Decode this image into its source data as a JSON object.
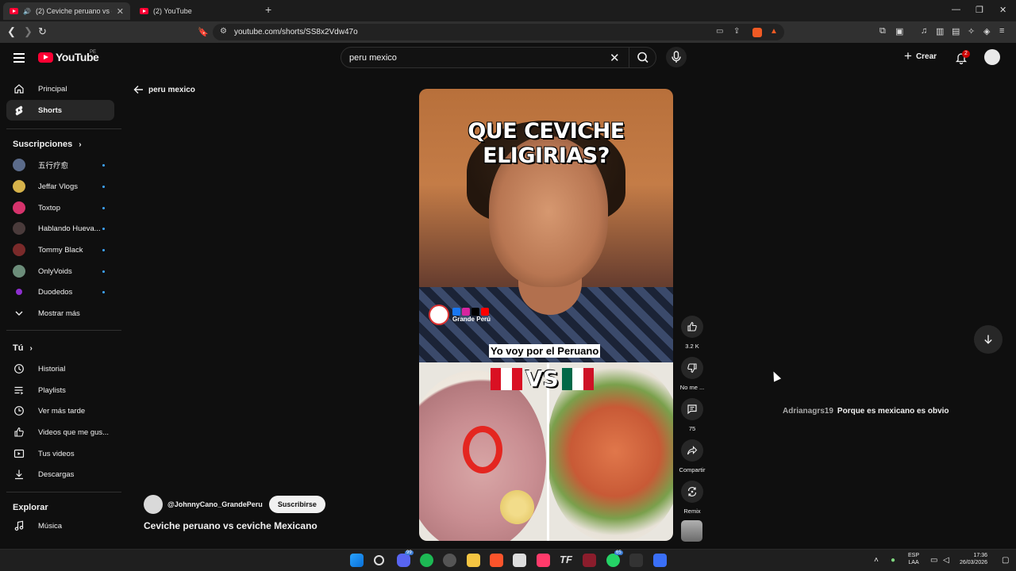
{
  "browser": {
    "tabs": [
      {
        "title": "(2) Ceviche peruano vs cevich",
        "active": true
      },
      {
        "title": "(2) YouTube",
        "active": false
      }
    ],
    "url": "youtube.com/shorts/SS8x2Vdw47o"
  },
  "header": {
    "logo": "YouTube",
    "country_code": "PE",
    "search_query": "peru mexico",
    "create_label": "Crear",
    "notification_count": "2"
  },
  "sidebar": {
    "main": [
      {
        "label": "Principal",
        "icon": "home-icon"
      },
      {
        "label": "Shorts",
        "icon": "shorts-icon"
      }
    ],
    "subscriptions_heading": "Suscripciones",
    "subscriptions": [
      {
        "label": "五行疗愈",
        "color": "#5b6b8a"
      },
      {
        "label": "Jeffar Vlogs",
        "color": "#d6b24a"
      },
      {
        "label": "Toxtop",
        "color": "#d6336c"
      },
      {
        "label": "Hablando Hueva...",
        "color": "#4a3b3b"
      },
      {
        "label": "Tommy Black",
        "color": "#7a2a2a"
      },
      {
        "label": "OnlyVoids",
        "color": "#6c8d7a"
      },
      {
        "label": "Duodedos",
        "color": "#8e2fd0"
      }
    ],
    "show_more": "Mostrar más",
    "you_heading": "Tú",
    "you": [
      {
        "label": "Historial",
        "icon": "history-icon"
      },
      {
        "label": "Playlists",
        "icon": "playlists-icon"
      },
      {
        "label": "Ver más tarde",
        "icon": "watch-later-icon"
      },
      {
        "label": "Videos que me gus...",
        "icon": "liked-icon"
      },
      {
        "label": "Tus videos",
        "icon": "your-videos-icon"
      },
      {
        "label": "Descargas",
        "icon": "downloads-icon"
      }
    ],
    "explore_heading": "Explorar",
    "explore": [
      {
        "label": "Música",
        "icon": "music-icon"
      }
    ]
  },
  "main": {
    "back_label": "peru mexico",
    "short": {
      "overlay_title": "QUE CEVICHE ELIGIRIAS?",
      "watermark": "Grande Perú",
      "caption": "Yo voy por el Peruano",
      "vs_text": "VS"
    },
    "actions": {
      "likes": "3.2 K",
      "dislike": "No me ...",
      "comments": "75",
      "share": "Compartir",
      "remix": "Remix"
    },
    "channel_handle": "@JohnnyCano_GrandePeru",
    "subscribe_label": "Suscribirse",
    "video_title": "Ceviche peruano vs ceviche Mexicano",
    "comment": {
      "user": "Adrianagrs19",
      "text": "Porque es mexicano es obvio"
    }
  },
  "taskbar": {
    "lang_top": "ESP",
    "lang_bottom": "LAA",
    "time": "17:36",
    "date": "26/03/2026",
    "badge_discord": "99",
    "badge_whatsapp": "65"
  }
}
